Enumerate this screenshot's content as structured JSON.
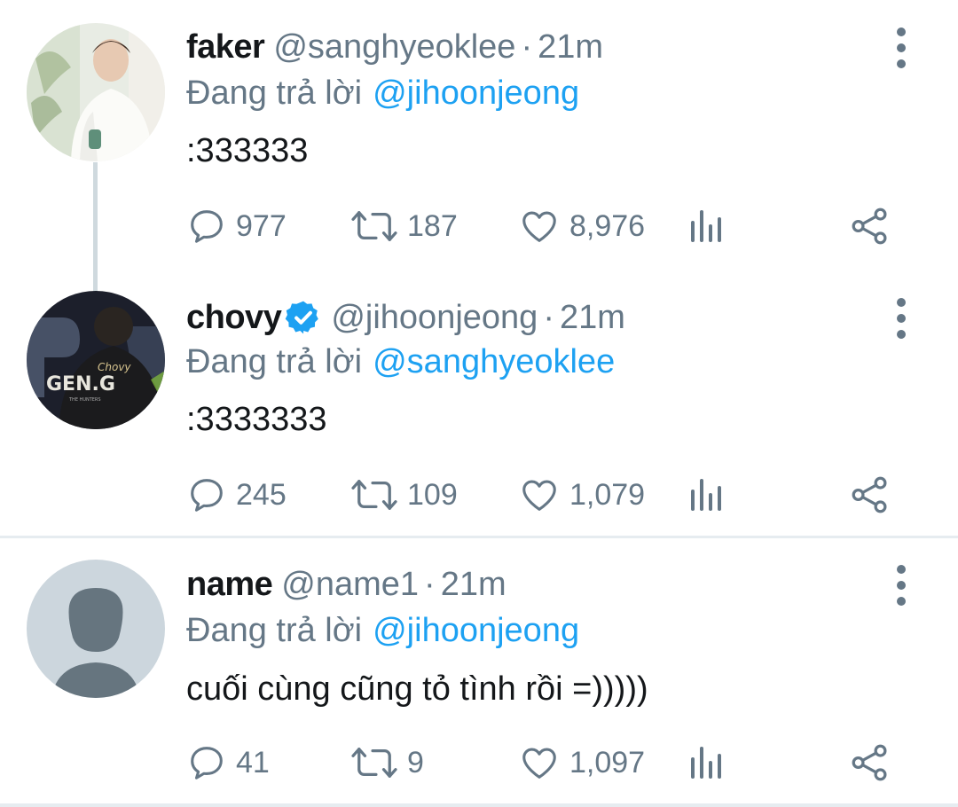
{
  "reply_prefix": "Đang trả lời",
  "tweets": [
    {
      "name": "faker",
      "handle": "@sanghyeoklee",
      "dot": "·",
      "time": "21m",
      "reply_to": "@jihoonjeong",
      "text": ":333333",
      "replies": "977",
      "retweets": "187",
      "likes": "8,976",
      "verified": false,
      "avatar": "photo-person-white-sweater"
    },
    {
      "name": "chovy",
      "handle": "@jihoonjeong",
      "dot": "·",
      "time": "21m",
      "reply_to": "@sanghyeoklee",
      "text": ":3333333",
      "replies": "245",
      "retweets": "109",
      "likes": "1,079",
      "verified": true,
      "avatar": "photo-gen-g-jersey"
    },
    {
      "name": "name",
      "handle": "@name1",
      "dot": "·",
      "time": "21m",
      "reply_to": "@jihoonjeong",
      "text": "cuối cùng cũng tỏ tình rồi =)))))",
      "replies": "41",
      "retweets": "9",
      "likes": "1,097",
      "verified": false,
      "avatar": "default-profile-silhouette"
    }
  ],
  "avatar_text": {
    "jersey_name": "Chovy",
    "jersey_team": "GEN.G",
    "jersey_sub": "THE HUNTERS"
  },
  "icons": {
    "reply": "reply-icon",
    "retweet": "retweet-icon",
    "like": "heart-icon",
    "analytics": "analytics-icon",
    "share": "share-icon",
    "more": "more-vertical-icon",
    "verified": "verified-badge-icon"
  },
  "colors": {
    "text_primary": "#14171a",
    "text_secondary": "#657786",
    "link": "#1da1f2",
    "verified": "#1da1f2",
    "separator": "#e6ecf0",
    "thread_line": "#cfd9de",
    "default_avatar_bg": "#ccd6dd",
    "default_avatar_fg": "#66757f"
  }
}
